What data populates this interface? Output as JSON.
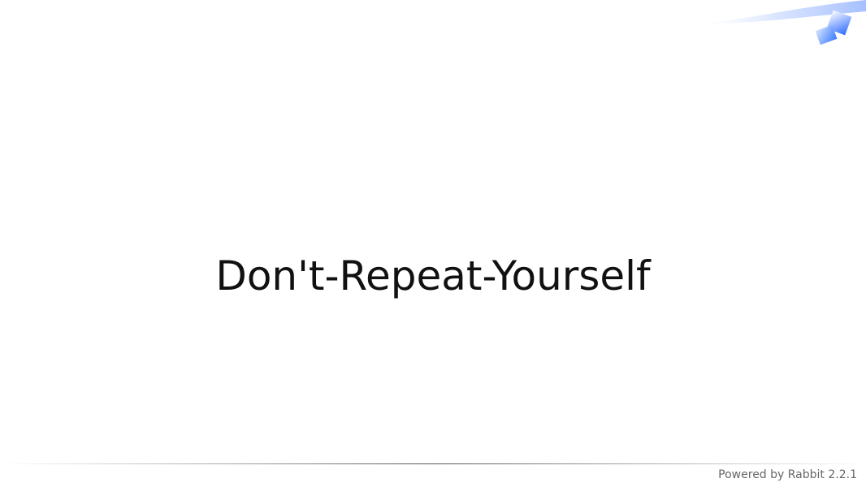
{
  "slide": {
    "title": "Don't-Repeat-Yourself"
  },
  "footer": {
    "text": "Powered by Rabbit 2.2.1"
  },
  "colors": {
    "title": "#111111",
    "footer": "#666666",
    "accent_blue": "#3a7bff",
    "rule": "#555555"
  },
  "decor": {
    "icon": "blue-squares-logo"
  }
}
